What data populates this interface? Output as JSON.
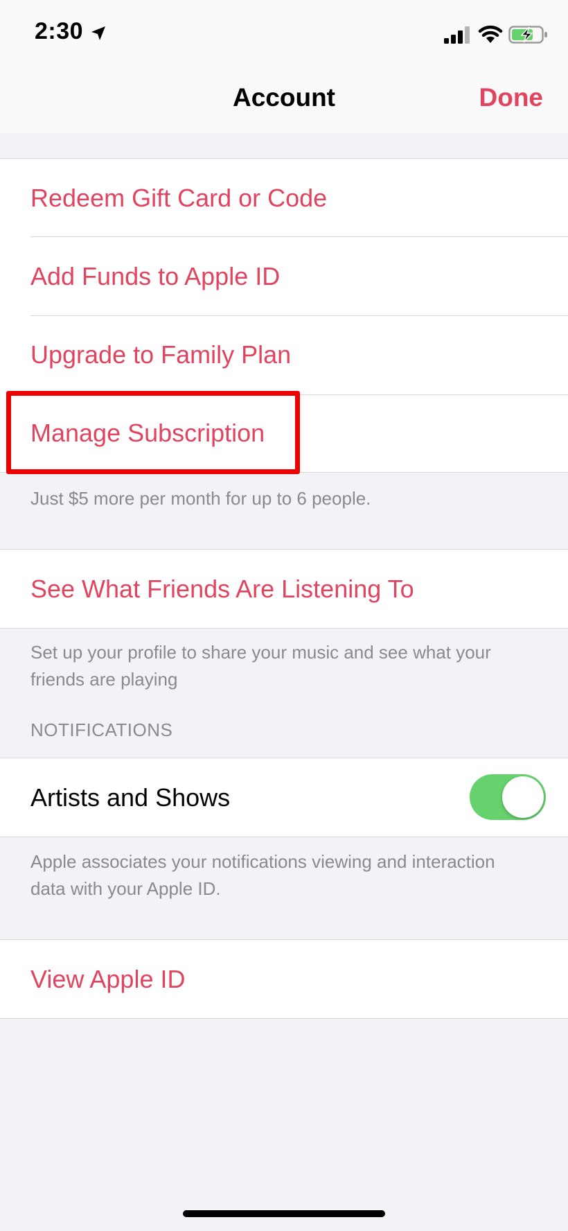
{
  "status_bar": {
    "time": "2:30"
  },
  "nav": {
    "title": "Account",
    "done_label": "Done"
  },
  "account_actions": [
    {
      "label": "Redeem Gift Card or Code"
    },
    {
      "label": "Add Funds to Apple ID"
    },
    {
      "label": "Upgrade to Family Plan"
    },
    {
      "label": "Manage Subscription"
    }
  ],
  "family_footer": "Just $5 more per month for up to 6 people.",
  "friends": {
    "label": "See What Friends Are Listening To",
    "footer": "Set up your profile to share your music and see what your friends are playing"
  },
  "notifications": {
    "header": "NOTIFICATIONS",
    "artists_label": "Artists and Shows",
    "artists_enabled": true,
    "footer": "Apple associates your notifications viewing and interaction data with your Apple ID."
  },
  "apple_id": {
    "label": "View Apple ID"
  },
  "colors": {
    "accent": "#E0445F",
    "toggle_on": "#65D26E",
    "highlight": "#EE0000",
    "background": "#F2F2F7"
  },
  "icons": {
    "location": "location-arrow-icon",
    "signal": "cellular-signal-icon",
    "wifi": "wifi-icon",
    "battery": "battery-charging-icon"
  }
}
